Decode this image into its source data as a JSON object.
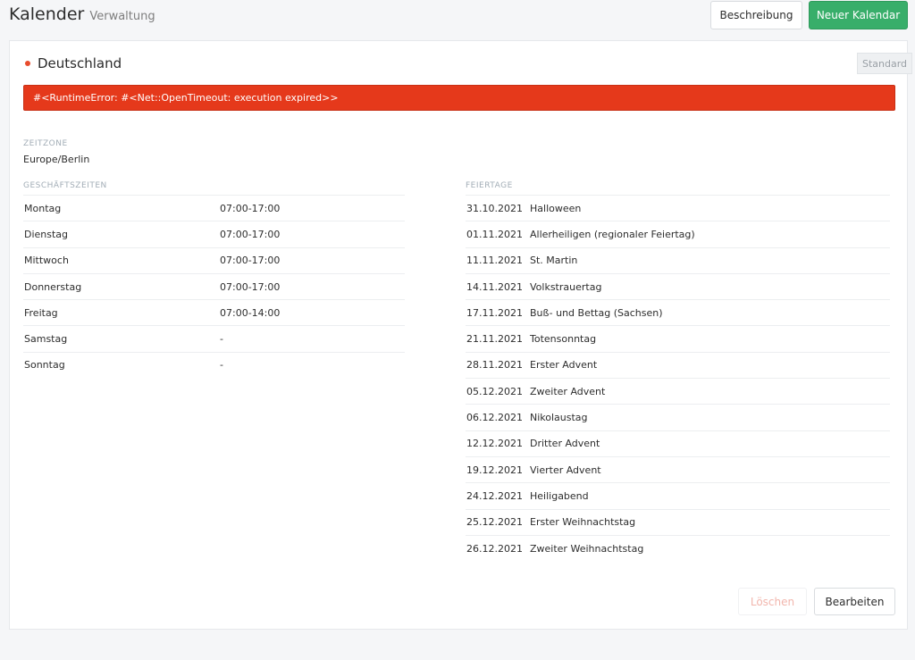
{
  "header": {
    "title": "Kalender",
    "subtitle": "Verwaltung",
    "description_button": "Beschreibung",
    "new_button": "Neuer Kalendar"
  },
  "calendar": {
    "name": "Deutschland",
    "badge": "Standard",
    "error": "#<RuntimeError: #<Net::OpenTimeout: execution expired>>",
    "timezone_label": "ZEITZONE",
    "timezone": "Europe/Berlin",
    "business_hours_label": "GESCHÄFTSZEITEN",
    "holidays_label": "FEIERTAGE",
    "business_hours": [
      {
        "day": "Montag",
        "time": "07:00-17:00"
      },
      {
        "day": "Dienstag",
        "time": "07:00-17:00"
      },
      {
        "day": "Mittwoch",
        "time": "07:00-17:00"
      },
      {
        "day": "Donnerstag",
        "time": "07:00-17:00"
      },
      {
        "day": "Freitag",
        "time": "07:00-14:00"
      },
      {
        "day": "Samstag",
        "time": "-"
      },
      {
        "day": "Sonntag",
        "time": "-"
      }
    ],
    "holidays": [
      {
        "date": "31.10.2021",
        "name": "Halloween"
      },
      {
        "date": "01.11.2021",
        "name": "Allerheiligen (regionaler Feiertag)"
      },
      {
        "date": "11.11.2021",
        "name": "St. Martin"
      },
      {
        "date": "14.11.2021",
        "name": "Volkstrauertag"
      },
      {
        "date": "17.11.2021",
        "name": "Buß- und Bettag (Sachsen)"
      },
      {
        "date": "21.11.2021",
        "name": "Totensonntag"
      },
      {
        "date": "28.11.2021",
        "name": "Erster Advent"
      },
      {
        "date": "05.12.2021",
        "name": "Zweiter Advent"
      },
      {
        "date": "06.12.2021",
        "name": "Nikolaustag"
      },
      {
        "date": "12.12.2021",
        "name": "Dritter Advent"
      },
      {
        "date": "19.12.2021",
        "name": "Vierter Advent"
      },
      {
        "date": "24.12.2021",
        "name": "Heiligabend"
      },
      {
        "date": "25.12.2021",
        "name": "Erster Weihnachtstag"
      },
      {
        "date": "26.12.2021",
        "name": "Zweiter Weihnachtstag"
      }
    ],
    "delete_button": "Löschen",
    "edit_button": "Bearbeiten"
  },
  "colors": {
    "accent_green": "#38ae6a",
    "error_red": "#e5391b",
    "status_dot": "#e84c2d"
  }
}
